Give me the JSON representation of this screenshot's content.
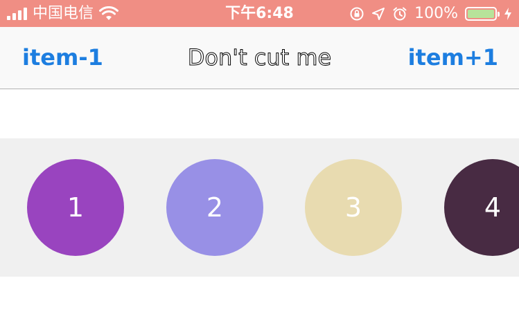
{
  "status_bar": {
    "carrier": "中国电信",
    "time": "下午6:48",
    "battery_percent": "100%",
    "battery_level": 1.0,
    "icons": [
      "signal-icon",
      "wifi-icon",
      "rotation-lock-icon",
      "location-icon",
      "alarm-icon",
      "battery-icon",
      "charging-icon"
    ]
  },
  "nav": {
    "left_item": "item-1",
    "title": "Don't cut me",
    "right_item": "item+1"
  },
  "carousel": {
    "items": [
      {
        "label": "1",
        "color": "#9944bf"
      },
      {
        "label": "2",
        "color": "#9890e6"
      },
      {
        "label": "3",
        "color": "#e8dbb0"
      },
      {
        "label": "4",
        "color": "#482b43"
      }
    ]
  },
  "colors": {
    "status_bar_bg": "#f08e84",
    "nav_tint": "#1d7ee0",
    "carousel_bg": "#f0f0f0"
  }
}
